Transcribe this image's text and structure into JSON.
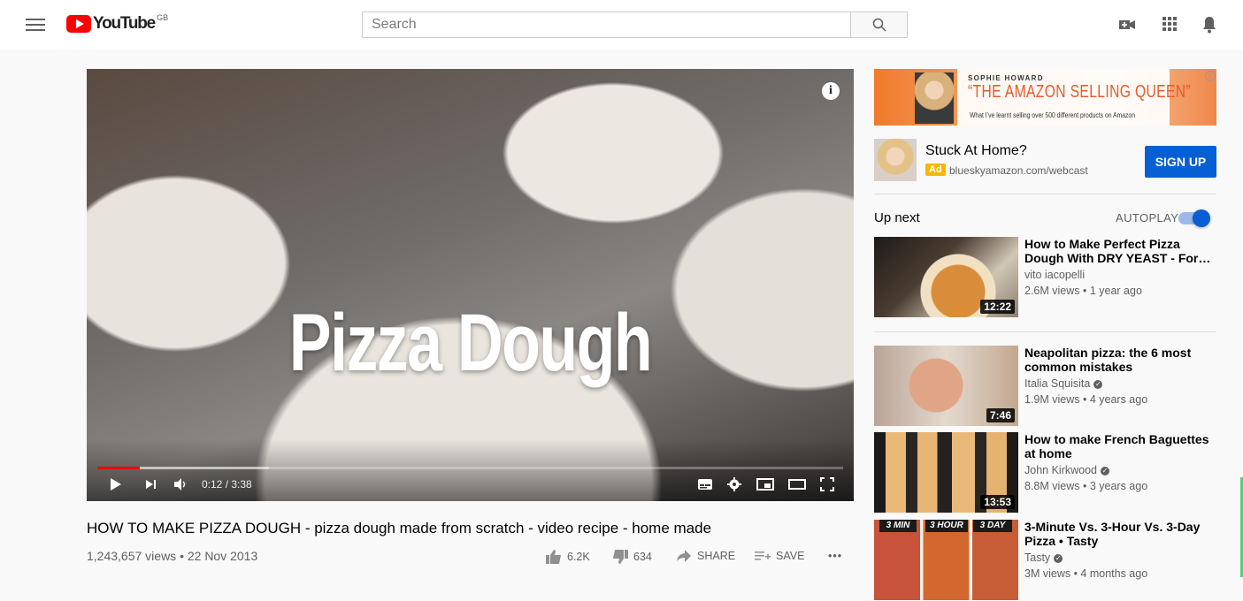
{
  "masthead": {
    "logo_text": "YouTube",
    "country_code": "GB",
    "search_placeholder": "Search",
    "icons": [
      "menu-icon",
      "search-icon",
      "create-video-icon",
      "apps-icon",
      "notifications-icon"
    ]
  },
  "player": {
    "overlay_title": "Pizza Dough",
    "info_glyph": "i",
    "time": "0:12 / 3:38",
    "progress_played": 0.057,
    "progress_loaded": 0.23
  },
  "video": {
    "title": "HOW TO MAKE PIZZA DOUGH - pizza dough made from scratch - video recipe - home made",
    "meta": "1,243,657 views • 22 Nov 2013",
    "likes": "6.2K",
    "dislikes": "634",
    "share_label": "SHARE",
    "save_label": "SAVE",
    "more_glyph": "•••"
  },
  "ad": {
    "kicker": "SOPHIE HOWARD",
    "headline": "“THE AMAZON SELLING QUEEN”",
    "sub": "What I’ve learnt selling over 500 different products on Amazon",
    "info_glyph": "i",
    "promo_title": "Stuck At Home?",
    "badge": "Ad",
    "url": "blueskyamazon.com/webcast",
    "cta": "SIGN UP"
  },
  "upnext": {
    "label": "Up next",
    "autoplay_label": "AUTOPLAY",
    "autoplay_on": true,
    "items": [
      {
        "title": "How to Make Perfect Pizza Dough With DRY YEAST - For…",
        "channel": "vito iacopelli",
        "verified": false,
        "views": "2.6M views • 1 year ago",
        "duration": "12:22"
      },
      {
        "title": "Neapolitan pizza: the 6 most common mistakes",
        "channel": "Italia Squisita",
        "verified": true,
        "views": "1.9M views • 4 years ago",
        "duration": "7:46"
      },
      {
        "title": "How to make French Baguettes at home",
        "channel": "John Kirkwood",
        "verified": true,
        "views": "8.8M views • 3 years ago",
        "duration": "13:53"
      },
      {
        "title": "3-Minute Vs. 3-Hour Vs. 3-Day Pizza • Tasty",
        "channel": "Tasty",
        "verified": true,
        "views": "3M views • 4 months ago",
        "thumb_labels": [
          "3 MIN",
          "3 HOUR",
          "3 DAY"
        ]
      }
    ]
  }
}
